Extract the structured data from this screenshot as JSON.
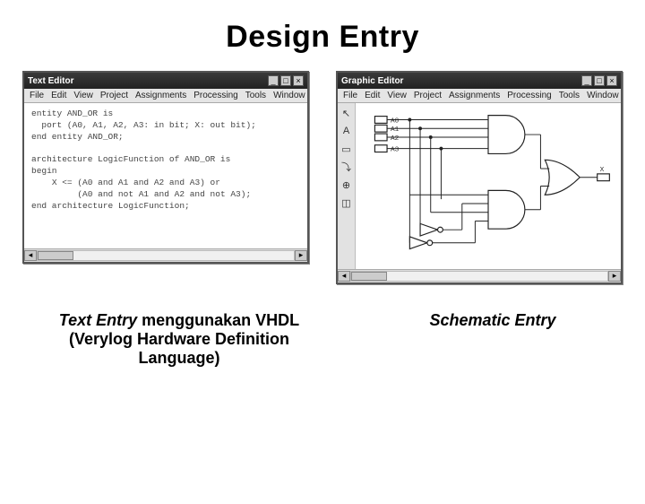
{
  "title": "Design Entry",
  "left_window": {
    "title": "Text Editor",
    "menu": [
      "File",
      "Edit",
      "View",
      "Project",
      "Assignments",
      "Processing",
      "Tools",
      "Window"
    ],
    "controls": [
      "_",
      "□",
      "×"
    ],
    "code": "entity AND_OR is\n  port (A0, A1, A2, A3: in bit; X: out bit);\nend entity AND_OR;\n\narchitecture LogicFunction of AND_OR is\nbegin\n    X <= (A0 and A1 and A2 and A3) or\n         (A0 and not A1 and A2 and not A3);\nend architecture LogicFunction;"
  },
  "right_window": {
    "title": "Graphic Editor",
    "menu": [
      "File",
      "Edit",
      "View",
      "Project",
      "Assignments",
      "Processing",
      "Tools",
      "Window"
    ],
    "controls": [
      "_",
      "□",
      "×"
    ],
    "tools": [
      "↖",
      "A",
      "▭",
      "⤵",
      "⊕",
      "◫"
    ],
    "pins": {
      "a0": "A0",
      "a1": "A1",
      "a2": "A2",
      "a3": "A3",
      "x": "X"
    }
  },
  "captions": {
    "left_em": "Text Entry",
    "left_rest": " menggunakan VHDL (Verylog Hardware Definition Language)",
    "right": "Schematic Entry"
  }
}
